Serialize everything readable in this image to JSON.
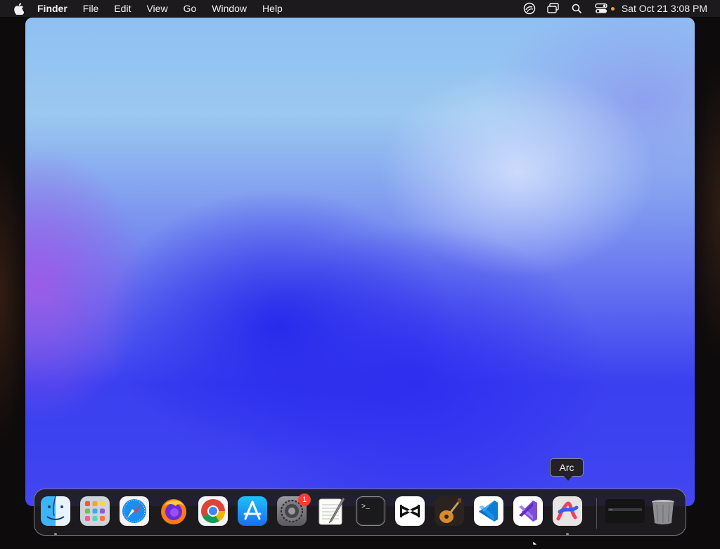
{
  "menubar": {
    "app_name": "Finder",
    "items": [
      "File",
      "Edit",
      "View",
      "Go",
      "Window",
      "Help"
    ],
    "datetime": "Sat Oct 21  3:08 PM",
    "status_icons": [
      "creative-cloud-icon",
      "screen-mirroring-icon",
      "spotlight-search-icon",
      "control-center-icon"
    ]
  },
  "tooltip": {
    "label": "Arc"
  },
  "dock": {
    "apps": [
      {
        "name": "Finder",
        "icon": "finder-icon",
        "running": true
      },
      {
        "name": "Launchpad",
        "icon": "launchpad-icon",
        "running": false
      },
      {
        "name": "Safari",
        "icon": "safari-icon",
        "running": false
      },
      {
        "name": "Firefox",
        "icon": "firefox-icon",
        "running": false
      },
      {
        "name": "Google Chrome",
        "icon": "chrome-icon",
        "running": false
      },
      {
        "name": "App Store",
        "icon": "app-store-icon",
        "running": false
      },
      {
        "name": "System Settings",
        "icon": "system-settings-icon",
        "running": false,
        "badge": "1"
      },
      {
        "name": "TextEdit",
        "icon": "textedit-icon",
        "running": false
      },
      {
        "name": "Terminal",
        "icon": "terminal-icon",
        "running": false
      },
      {
        "name": "CapCut",
        "icon": "capcut-icon",
        "running": false
      },
      {
        "name": "GarageBand",
        "icon": "garageband-icon",
        "running": false
      },
      {
        "name": "Visual Studio Code",
        "icon": "vscode-icon",
        "running": false
      },
      {
        "name": "Visual Studio",
        "icon": "visual-studio-icon",
        "running": false
      },
      {
        "name": "Arc",
        "icon": "arc-icon",
        "running": true
      }
    ],
    "system_settings_badge": "1",
    "trash": {
      "icon": "trash-icon"
    },
    "minimized_window": {
      "icon": "minimized-window-thumbnail"
    }
  },
  "colors": {
    "menubar_bg": "#1c1a1c",
    "dock_bg": "#1e1c20",
    "badge": "#ff3b30",
    "status_dot": "#f5a623"
  }
}
